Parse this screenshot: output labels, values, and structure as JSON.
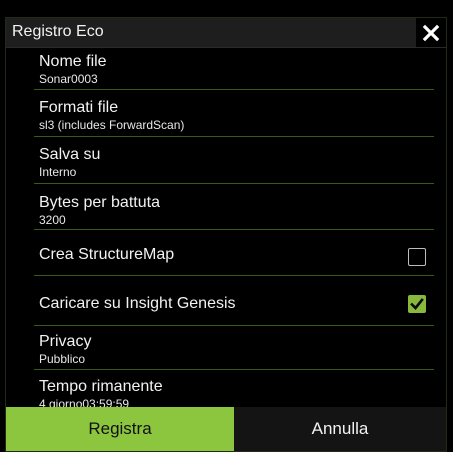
{
  "dialog": {
    "title": "Registro Eco",
    "close_icon": "close-icon"
  },
  "items": [
    {
      "label": "Nome file",
      "value": "Sonar0003"
    },
    {
      "label": "Formati file",
      "value": "sl3 (includes ForwardScan)"
    },
    {
      "label": "Salva su",
      "value": "Interno"
    },
    {
      "label": "Bytes per battuta",
      "value": "3200"
    },
    {
      "label": "Crea StructureMap",
      "checked": false
    },
    {
      "label": "Caricare su Insight Genesis",
      "checked": true
    },
    {
      "label": "Privacy",
      "value": "Pubblico"
    },
    {
      "label": "Tempo rimanente",
      "value": "4 giorno03:59:59"
    }
  ],
  "footer": {
    "record_label": "Registra",
    "cancel_label": "Annulla"
  },
  "colors": {
    "accent": "#8cc63f",
    "separator": "#3a5a1a"
  }
}
